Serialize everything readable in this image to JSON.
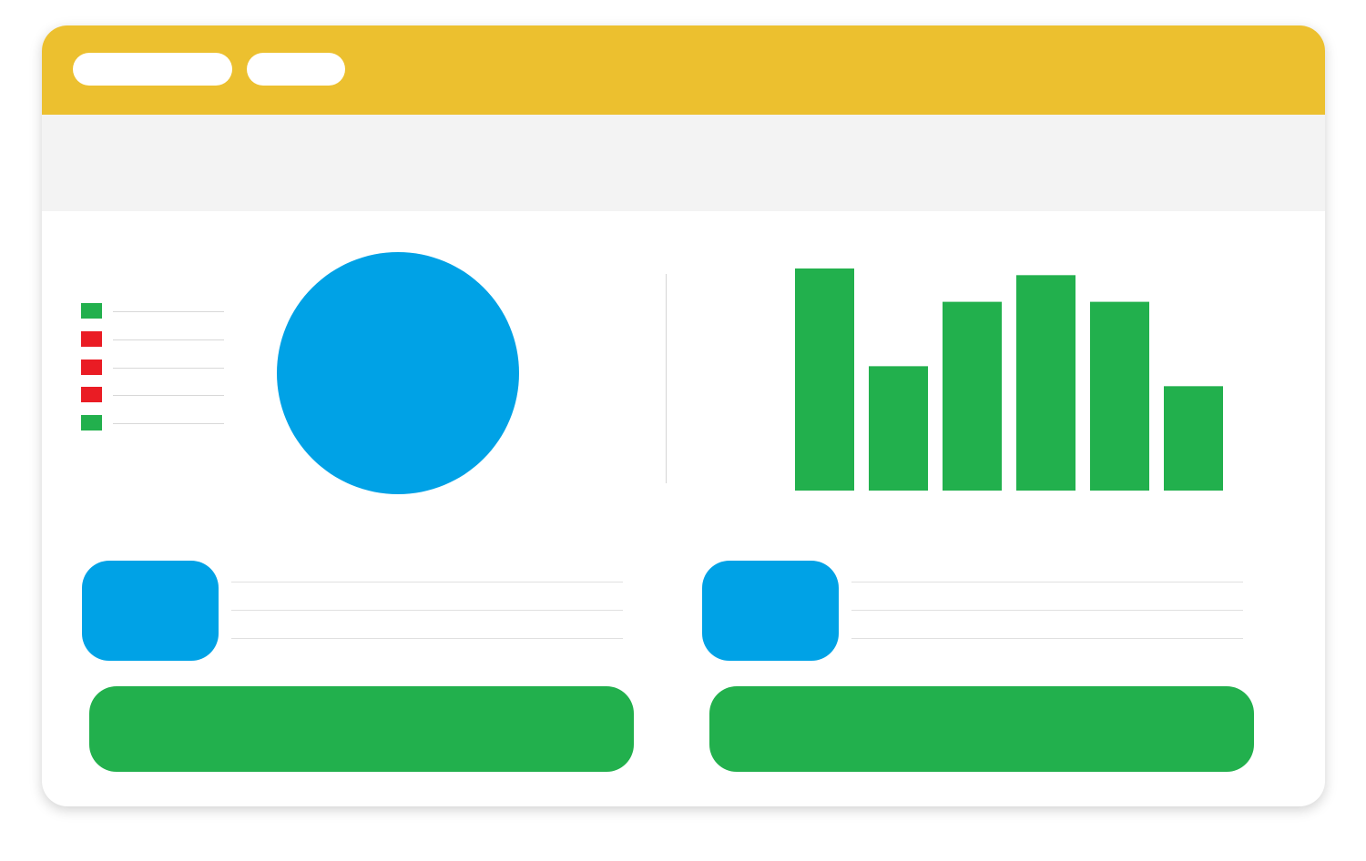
{
  "colors": {
    "titlebar": "#ecc02f",
    "toolbar": "#f3f3f3",
    "accent_blue": "#00a2e6",
    "accent_green": "#22b04d",
    "status_red": "#ea1c24"
  },
  "tabs": [
    {
      "label": ""
    },
    {
      "label": ""
    }
  ],
  "legend": {
    "items": [
      {
        "status": "green",
        "color": "#22b04d",
        "label": ""
      },
      {
        "status": "red",
        "color": "#ea1c24",
        "label": ""
      },
      {
        "status": "red",
        "color": "#ea1c24",
        "label": ""
      },
      {
        "status": "red",
        "color": "#ea1c24",
        "label": ""
      },
      {
        "status": "green",
        "color": "#22b04d",
        "label": ""
      }
    ]
  },
  "chart_data": [
    {
      "type": "pie",
      "values": [
        1
      ],
      "colors": [
        "#00a2e6"
      ],
      "title": ""
    },
    {
      "type": "bar",
      "categories": [
        "",
        "",
        "",
        "",
        "",
        ""
      ],
      "values": [
        100,
        56,
        85,
        97,
        85,
        47
      ],
      "ylim": [
        0,
        100
      ],
      "color": "#22b04d",
      "title": "",
      "xlabel": "",
      "ylabel": ""
    }
  ],
  "cards": [
    {
      "thumb_color": "#00a2e6",
      "lines": [
        "",
        "",
        ""
      ],
      "button_label": ""
    },
    {
      "thumb_color": "#00a2e6",
      "lines": [
        "",
        "",
        ""
      ],
      "button_label": ""
    }
  ]
}
